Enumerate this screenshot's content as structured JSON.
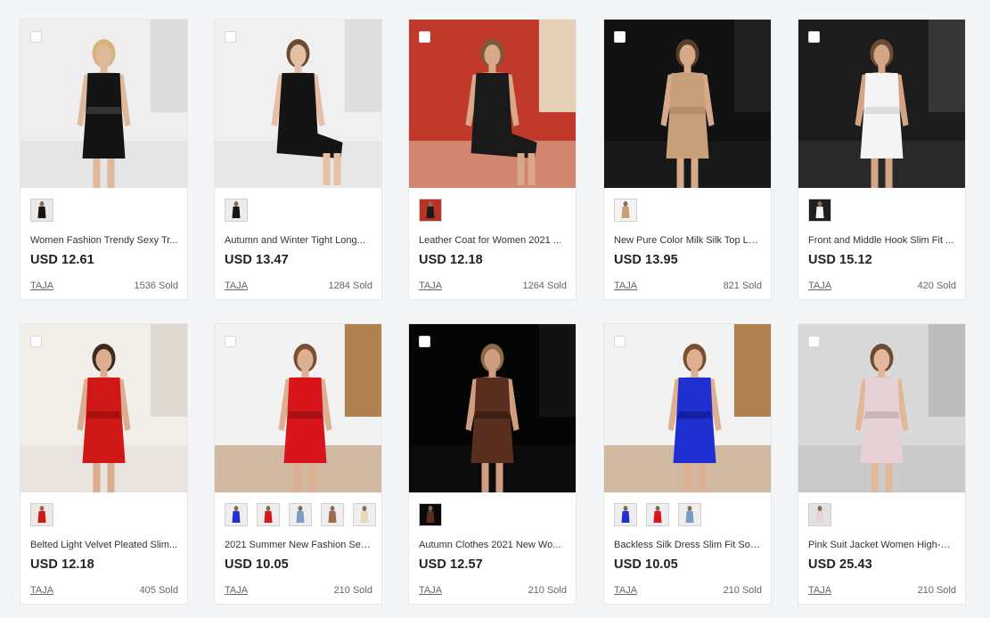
{
  "products": [
    {
      "title": "Women Fashion Trendy Sexy Tr...",
      "price": "USD 12.61",
      "store": "TAJA",
      "sold": "1536 Sold",
      "photo": {
        "bg": "#eeeeee",
        "bg2": "#d9d9d9",
        "skin": "#e0b89a",
        "hair": "#d7b47c",
        "outfit": "#141414",
        "outfit2": "#333333",
        "pose": "standing"
      },
      "swatches": [
        {
          "bg": "#e8e8e8",
          "outfit": "#151515"
        }
      ]
    },
    {
      "title": "Autumn and Winter Tight Long...",
      "price": "USD 13.47",
      "store": "TAJA",
      "sold": "1284 Sold",
      "photo": {
        "bg": "#f1f0f0",
        "bg2": "#dcdcdc",
        "skin": "#e6c0a5",
        "hair": "#6b4a36",
        "outfit": "#141414",
        "outfit2": "#2c2c2c",
        "pose": "sitting"
      },
      "swatches": [
        {
          "bg": "#ececec",
          "outfit": "#161616"
        }
      ]
    },
    {
      "title": "Leather Coat for Women 2021 ...",
      "price": "USD 12.18",
      "store": "TAJA",
      "sold": "1264 Sold",
      "photo": {
        "bg": "#c0392b",
        "bg2": "#e8e2c8",
        "skin": "#d9a888",
        "hair": "#7a5a3c",
        "outfit": "#1a1a1a",
        "outfit2": "#b0b0b0",
        "pose": "sitting"
      },
      "swatches": [
        {
          "bg": "#b83227",
          "outfit": "#1a1a1a"
        }
      ]
    },
    {
      "title": "New Pure Color Milk Silk Top Lo...",
      "price": "USD 13.95",
      "store": "TAJA",
      "sold": "821 Sold",
      "photo": {
        "bg": "#111111",
        "bg2": "#222222",
        "skin": "#d6a98a",
        "hair": "#5a3b28",
        "outfit": "#c7a07a",
        "outfit2": "#b68d66",
        "pose": "standing"
      },
      "swatches": [
        {
          "bg": "#f3f3f3",
          "outfit": "#c7a07a"
        }
      ]
    },
    {
      "title": "Front and Middle Hook Slim Fit ...",
      "price": "USD 15.12",
      "store": "TAJA",
      "sold": "420 Sold",
      "photo": {
        "bg": "#1c1c1c",
        "bg2": "#3a3a3a",
        "skin": "#d4a585",
        "hair": "#6d4b32",
        "outfit": "#f4f4f4",
        "outfit2": "#dcdcdc",
        "pose": "standing"
      },
      "swatches": [
        {
          "bg": "#1f1f1f",
          "outfit": "#f4f4f4"
        }
      ]
    },
    {
      "title": "Belted Light Velvet Pleated Slim...",
      "price": "USD 12.18",
      "store": "TAJA",
      "sold": "405 Sold",
      "photo": {
        "bg": "#f2eeea",
        "bg2": "#ddd6cf",
        "skin": "#dcae8f",
        "hair": "#3b2a20",
        "outfit": "#d01818",
        "outfit2": "#a81010",
        "pose": "standing"
      },
      "swatches": [
        {
          "bg": "#eee8e2",
          "outfit": "#d01818"
        }
      ]
    },
    {
      "title": "2021 Summer New Fashion Sex...",
      "price": "USD 10.05",
      "store": "TAJA",
      "sold": "210 Sold",
      "photo": {
        "bg": "#f2f2f2",
        "bg2": "#a8743f",
        "skin": "#ddb091",
        "hair": "#7a4f30",
        "outfit": "#d8151b",
        "outfit2": "#a60f14",
        "pose": "leaning"
      },
      "swatches": [
        {
          "bg": "#eeeeee",
          "outfit": "#1f2fd0"
        },
        {
          "bg": "#eeeeee",
          "outfit": "#d8151b"
        },
        {
          "bg": "#eeeeee",
          "outfit": "#7a9cc4"
        },
        {
          "bg": "#eeeeee",
          "outfit": "#a06a4a"
        },
        {
          "bg": "#eeeeee",
          "outfit": "#e8d8b8"
        }
      ]
    },
    {
      "title": "Autumn Clothes 2021 New Wo...",
      "price": "USD 12.57",
      "store": "TAJA",
      "sold": "210 Sold",
      "photo": {
        "bg": "#050505",
        "bg2": "#141414",
        "skin": "#cf9e80",
        "hair": "#8a6a48",
        "outfit": "#5a2e1f",
        "outfit2": "#3e1f14",
        "pose": "standing"
      },
      "swatches": [
        {
          "bg": "#0a0a0a",
          "outfit": "#5a2e1f"
        }
      ]
    },
    {
      "title": "Backless Silk Dress Slim Fit Soci...",
      "price": "USD 10.05",
      "store": "TAJA",
      "sold": "210 Sold",
      "photo": {
        "bg": "#f2f2f2",
        "bg2": "#a8743f",
        "skin": "#ddb091",
        "hair": "#7a4f30",
        "outfit": "#1f2fd0",
        "outfit2": "#1420a0",
        "pose": "leaning"
      },
      "swatches": [
        {
          "bg": "#eeeeee",
          "outfit": "#1f2fd0"
        },
        {
          "bg": "#eeeeee",
          "outfit": "#d8151b"
        },
        {
          "bg": "#eeeeee",
          "outfit": "#7a9cc4"
        }
      ]
    },
    {
      "title": "Pink Suit Jacket Women High-G...",
      "price": "USD 25.43",
      "store": "TAJA",
      "sold": "210 Sold",
      "photo": {
        "bg": "#d9d9d9",
        "bg2": "#b8b8b8",
        "skin": "#e2b79a",
        "hair": "#6a4a34",
        "outfit": "#e6d2d6",
        "outfit2": "#cdb4ba",
        "pose": "standing"
      },
      "swatches": [
        {
          "bg": "#e2e2e2",
          "outfit": "#e6d2d6"
        }
      ]
    }
  ]
}
